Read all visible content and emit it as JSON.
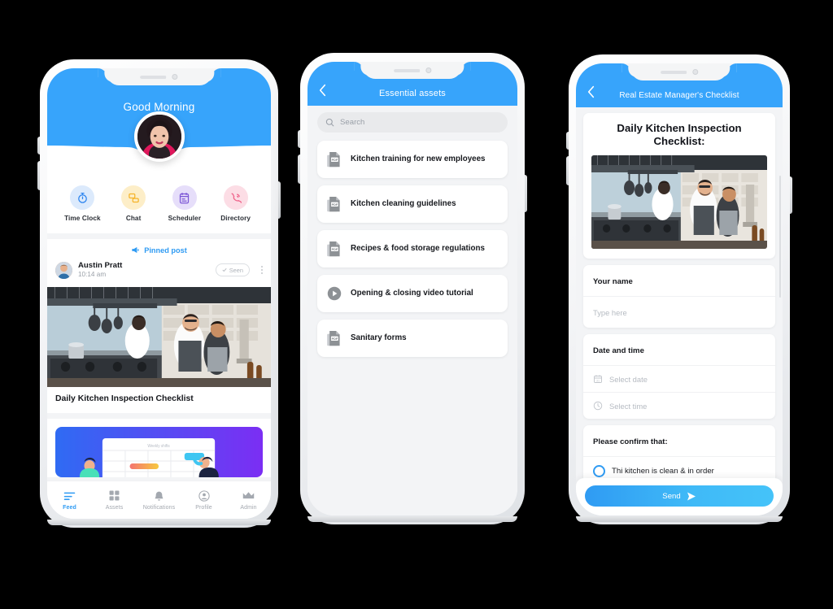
{
  "colors": {
    "brand_blue": "#37a4fb",
    "accent_blue": "#2f9bf3",
    "page_bg": "#f3f4f6",
    "text_dark": "#16181d",
    "text_muted": "#9aa0a8",
    "canvas": "#000000"
  },
  "phone1": {
    "greeting": "Good Morning",
    "avatar_icon": "user-photo-avatar",
    "quick_actions": [
      {
        "label": "Time Clock",
        "icon": "stopwatch-icon",
        "bg": "#dceafc",
        "fg": "#2f86ef"
      },
      {
        "label": "Chat",
        "icon": "chat-bubble-icon",
        "bg": "#fdeec8",
        "fg": "#f5b42a"
      },
      {
        "label": "Scheduler",
        "icon": "clipboard-calendar-icon",
        "bg": "#e6defa",
        "fg": "#7b56d6"
      },
      {
        "label": "Directory",
        "icon": "phone-ring-icon",
        "bg": "#fcdde5",
        "fg": "#ef5f87"
      }
    ],
    "feed": {
      "pinned_label": "Pinned post",
      "pinned_icon": "megaphone-pin-icon",
      "post": {
        "author": "Austin Pratt",
        "author_avatar_icon": "author-avatar",
        "time": "10:14 am",
        "seen_label": "Seen",
        "seen_icon": "check-icon",
        "menu_icon": "kebab-menu-icon",
        "image_alt": "commercial-kitchen-staff-photo",
        "caption": "Daily Kitchen Inspection Checklist"
      },
      "post2": {
        "image_alt": "weekly-shifts-illustration",
        "illustration_title": "Weekly shifts"
      }
    },
    "tabs": [
      {
        "label": "Feed",
        "icon": "feed-lines-icon",
        "active": true
      },
      {
        "label": "Assets",
        "icon": "grid-squares-icon",
        "active": false
      },
      {
        "label": "Notifications",
        "icon": "bell-icon",
        "active": false
      },
      {
        "label": "Profile",
        "icon": "person-circle-icon",
        "active": false
      },
      {
        "label": "Admin",
        "icon": "crown-icon",
        "active": false
      }
    ]
  },
  "phone2": {
    "back_icon": "chevron-left-icon",
    "title": "Essential assets",
    "search": {
      "placeholder": "Search",
      "icon": "search-icon"
    },
    "assets": [
      {
        "title": "Kitchen training for new employees",
        "icon": "pdf-file-icon"
      },
      {
        "title": "Kitchen cleaning guidelines",
        "icon": "pdf-file-icon"
      },
      {
        "title": "Recipes & food storage regulations",
        "icon": "pdf-file-icon"
      },
      {
        "title": "Opening & closing video tutorial",
        "icon": "play-circle-icon"
      },
      {
        "title": "Sanitary forms",
        "icon": "pdf-file-icon"
      }
    ]
  },
  "phone3": {
    "back_icon": "chevron-left-icon",
    "title": "Real Estate Manager's Checklist",
    "form_title": "Daily Kitchen Inspection Checklist:",
    "image_alt": "commercial-kitchen-staff-photo",
    "fields": [
      {
        "label": "Your name",
        "placeholder": "Type here",
        "icon": ""
      },
      {
        "label": "Date and time",
        "placeholder": "Select date",
        "icon": "calendar-icon"
      },
      {
        "label": "",
        "placeholder": "Select time",
        "icon": "clock-icon"
      }
    ],
    "section": {
      "label": "Please confirm that:",
      "option": "Thi kitchen is clean & in order",
      "option_icon": "radio-unchecked-icon"
    },
    "submit": {
      "label": "Send",
      "icon": "send-arrow-icon"
    }
  }
}
